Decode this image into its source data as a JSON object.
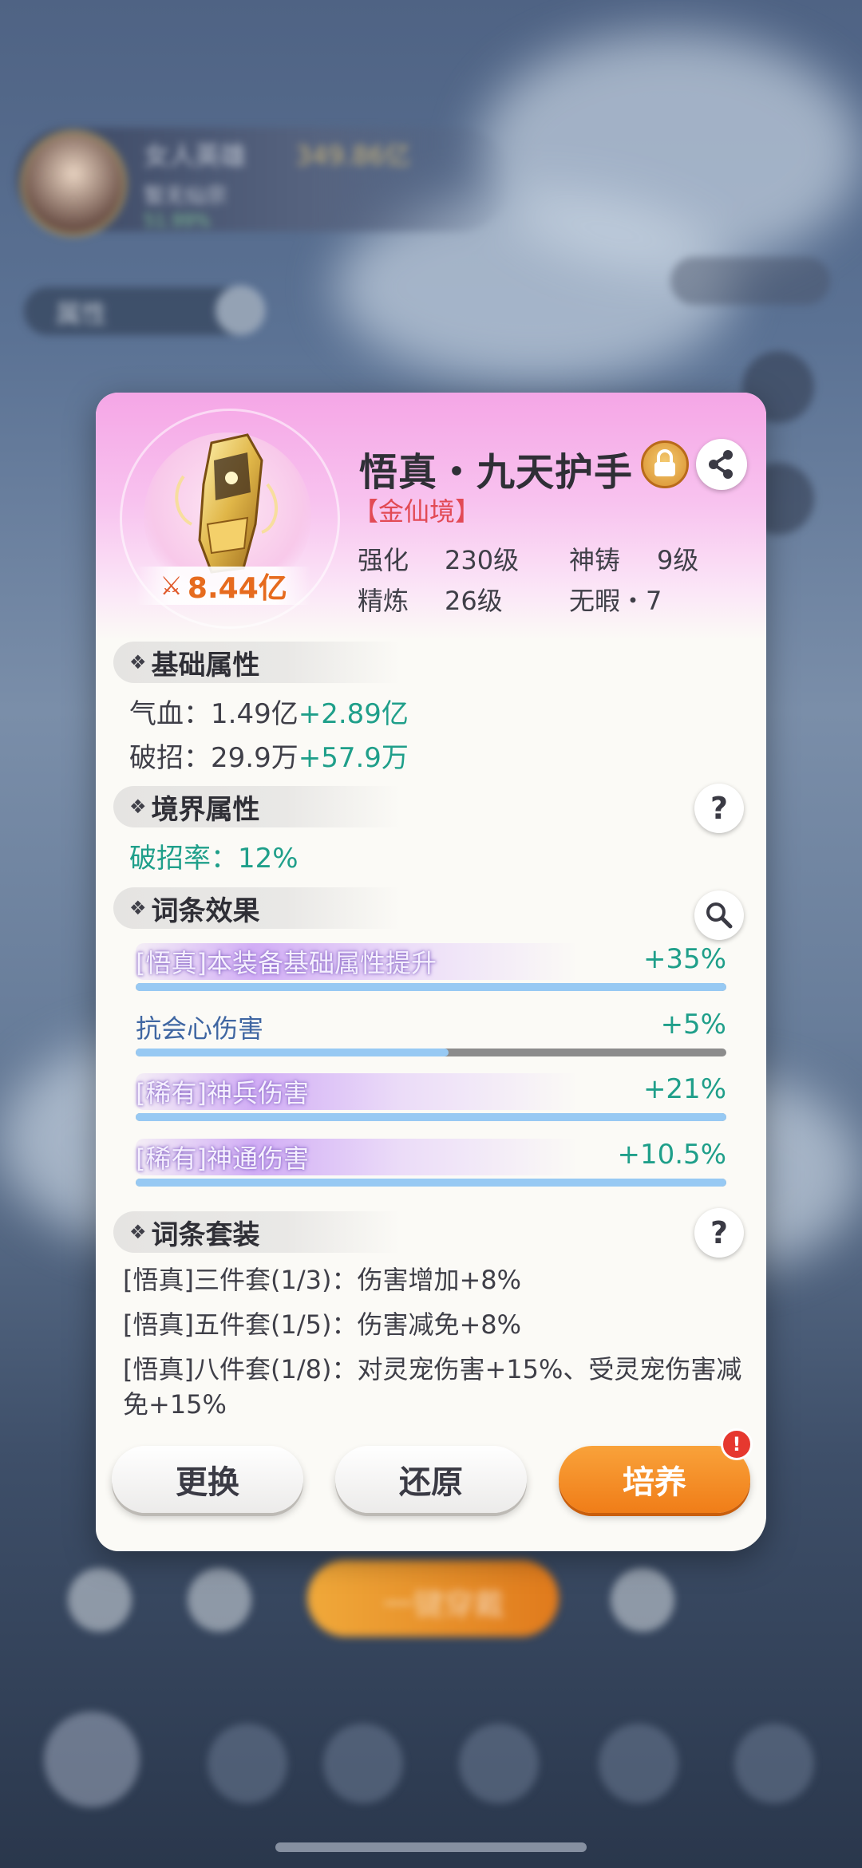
{
  "background": {
    "player_name": "女人英雄",
    "player_power": "349.86亿",
    "player_sub": "暂无仙宗",
    "player_progress": "51.99%",
    "tab_label": "属性",
    "main_button": "一键穿戴"
  },
  "item": {
    "name": "悟真・九天护手",
    "rank": "【金仙境】",
    "power_icon": "crossed-swords-icon",
    "power": "8.44亿",
    "stats": {
      "enhance_label": "强化",
      "enhance_value": "230级",
      "forge_label": "神铸",
      "forge_value": "9级",
      "refine_label": "精炼",
      "refine_value": "26级",
      "flawless_label": "无暇・7"
    }
  },
  "sections": {
    "base": {
      "title": "基础属性",
      "hp_label": "气血：1.49亿",
      "hp_bonus": "+2.89亿",
      "break_label": "破招：29.9万",
      "break_bonus": "+57.9万"
    },
    "realm": {
      "title": "境界属性",
      "line": "破招率：12%"
    },
    "affix": {
      "title": "词条效果",
      "items": [
        {
          "name": "[悟真]本装备基础属性提升",
          "value": "+35%",
          "fill": 1.0,
          "style": "glow"
        },
        {
          "name": "抗会心伤害",
          "value": "+5%",
          "fill": 0.53,
          "style": "plain"
        },
        {
          "name": "[稀有]神兵伤害",
          "value": "+21%",
          "fill": 1.0,
          "style": "glow"
        },
        {
          "name": "[稀有]神通伤害",
          "value": "+10.5%",
          "fill": 1.0,
          "style": "glow"
        }
      ]
    },
    "set": {
      "title": "词条套装",
      "lines": [
        "[悟真]三件套(1/3)：伤害增加+8%",
        "[悟真]五件套(1/5)：伤害减免+8%",
        "[悟真]八件套(1/8)：对灵宠伤害+15%、受灵宠伤害减免+15%"
      ]
    }
  },
  "buttons": {
    "replace": "更换",
    "restore": "还原",
    "cultivate": "培养",
    "alert": "!"
  },
  "colors": {
    "accent_green": "#1f9f8a",
    "rank_red": "#e24a55",
    "power_orange": "#e66b1e",
    "cultivate_orange": "#f07d18"
  }
}
